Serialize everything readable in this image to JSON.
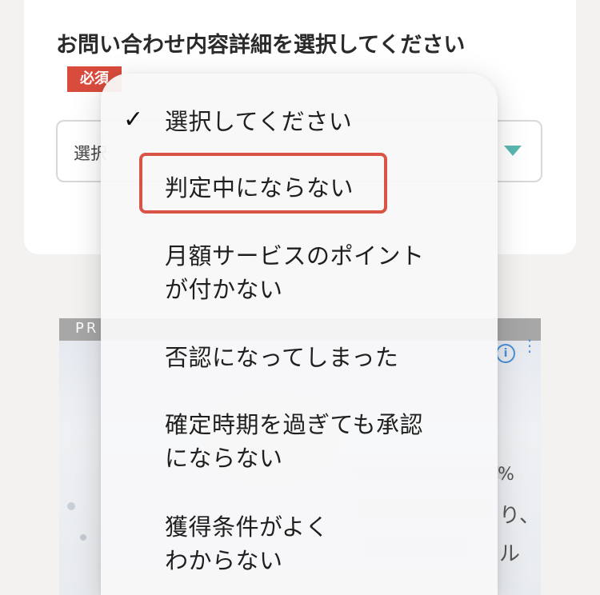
{
  "form": {
    "title": "お問い合わせ内容詳細を選択してください",
    "required_badge": "必須",
    "select_value": "選択"
  },
  "ad": {
    "pr_label": "PR",
    "info_symbol": "i",
    "menu_symbol": "⋮",
    "pct": "%",
    "text1": "り、",
    "text2": "ル"
  },
  "dropdown": {
    "check_symbol": "✓",
    "options": [
      {
        "lines": [
          "選択してください"
        ]
      },
      {
        "lines": [
          "判定中にならない"
        ]
      },
      {
        "lines": [
          "月額サービスのポイント",
          "が付かない"
        ]
      },
      {
        "lines": [
          "否認になってしまった"
        ]
      },
      {
        "lines": [
          "確定時期を過ぎても承認",
          "にならない"
        ]
      },
      {
        "lines": [
          "獲得条件がよく",
          "わからない"
        ]
      }
    ],
    "selected_index": 0,
    "highlight_index": 1,
    "highlight_color": "#d95445"
  },
  "colors": {
    "required_bg": "#d94b3c",
    "select_arrow": "#5bb7b2",
    "page_bg": "#f3f2f1"
  }
}
